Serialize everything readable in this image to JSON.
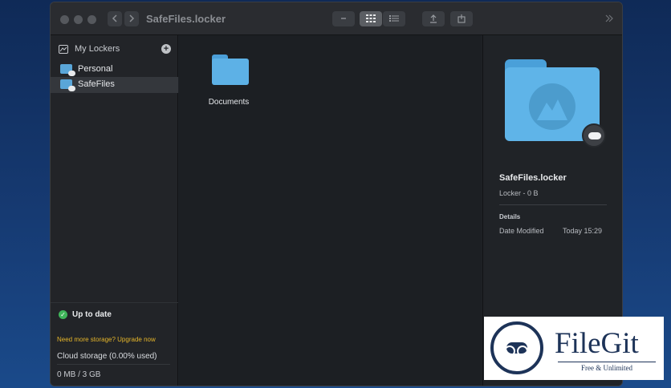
{
  "window": {
    "title": "SafeFiles.locker"
  },
  "toolbar": {
    "back_icon": "chevron-left-icon",
    "forward_icon": "chevron-right-icon",
    "view_options": [
      "minus-icon",
      "grid-icon",
      "list-icon"
    ],
    "active_view": "grid-icon",
    "actions": [
      "upload-icon",
      "share-icon"
    ],
    "overflow_icon": "double-chevron-right-icon"
  },
  "sidebar": {
    "header_label": "My Lockers",
    "items": [
      {
        "label": "Personal",
        "selected": false
      },
      {
        "label": "SafeFiles",
        "selected": true
      }
    ],
    "status": "Up to date",
    "upgrade_text": "Need more storage? Upgrade now",
    "cloud_storage": "Cloud storage (0.00% used)",
    "usage": "0 MB / 3 GB"
  },
  "content": {
    "items": [
      {
        "label": "Documents"
      }
    ]
  },
  "inspector": {
    "name": "SafeFiles.locker",
    "subtitle": "Locker - 0 B",
    "details_heading": "Details",
    "date_modified_label": "Date Modified",
    "date_modified_value": "Today 15:29"
  },
  "watermark": {
    "name": "FileGit",
    "tagline": "Free & Unlimited"
  },
  "colors": {
    "folder_blue": "#5db1e6",
    "status_green": "#3fb55a",
    "upgrade_yellow": "#e5b52a",
    "watermark_navy": "#1d3358"
  }
}
